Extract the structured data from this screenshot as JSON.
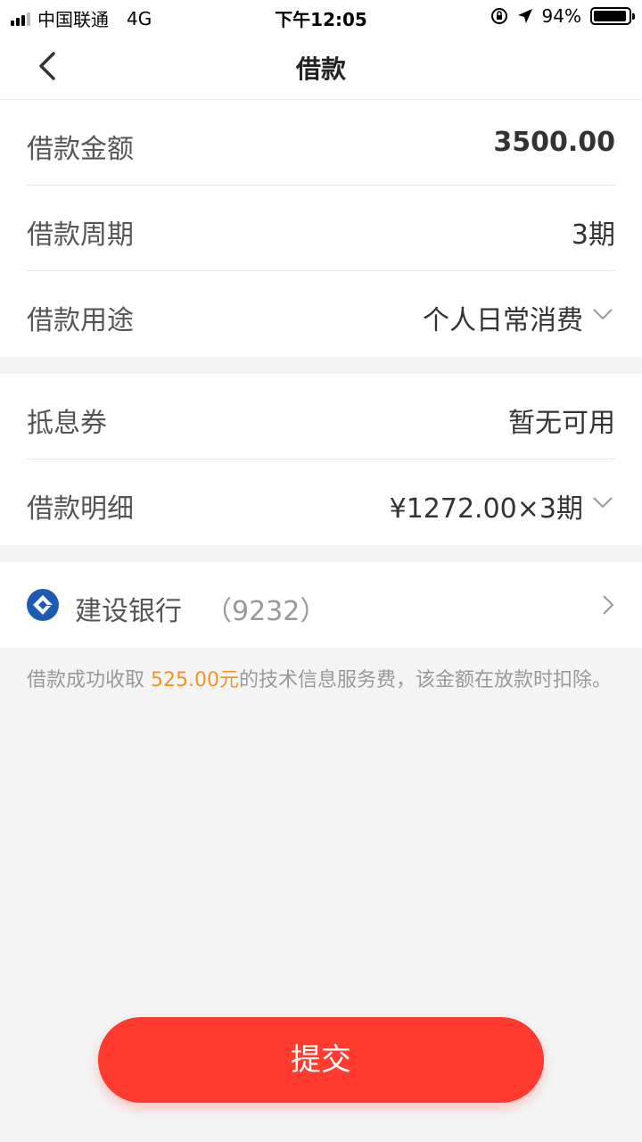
{
  "status_bar": {
    "carrier": "中国联通",
    "network": "4G",
    "time": "下午12:05",
    "battery": "94%"
  },
  "nav": {
    "title": "借款"
  },
  "loan_rows": [
    {
      "label": "借款金额",
      "value": "3500.00"
    },
    {
      "label": "借款周期",
      "value": "3期"
    },
    {
      "label": "借款用途",
      "value": "个人日常消费"
    }
  ],
  "detail_rows": [
    {
      "label": "抵息券",
      "value": "暂无可用"
    },
    {
      "label": "借款明细",
      "value": "¥1272.00×3期"
    }
  ],
  "bank": {
    "name": "建设银行",
    "card_tail": "（9232）"
  },
  "notice": {
    "prefix": "借款成功收取 ",
    "fee": "525.00元",
    "suffix": "的技术信息服务费，该金额在放款时扣除。"
  },
  "submit_label": "提交",
  "colors": {
    "accent_orange": "#f7931e",
    "submit_red": "#ff3b2f",
    "bank_blue": "#1d5bb0"
  }
}
